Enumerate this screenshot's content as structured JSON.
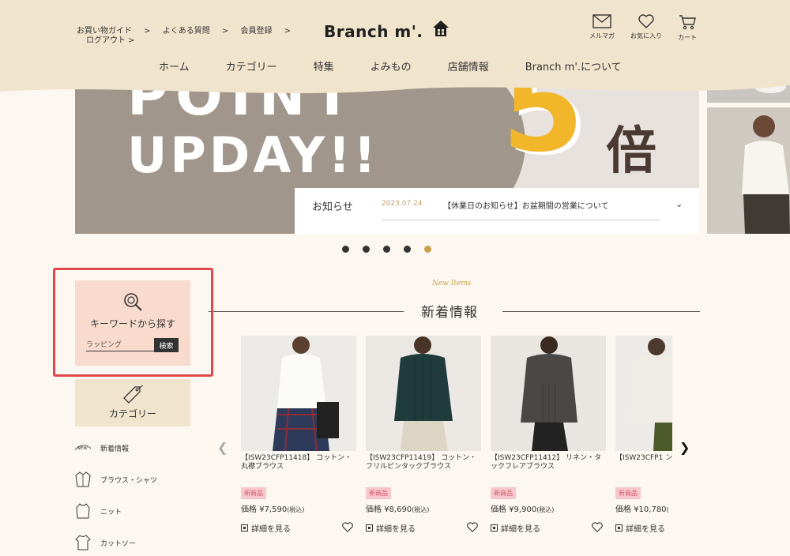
{
  "header": {
    "guide_links_row1": [
      "お買い物ガイド",
      "よくある質問",
      "会員登録"
    ],
    "guide_links_row2": [
      "ログアウト"
    ],
    "logo_text": "Branch m'.",
    "icons": [
      {
        "name": "mail-icon",
        "label": "メルマガ"
      },
      {
        "name": "heart-icon",
        "label": "お気に入り"
      },
      {
        "name": "cart-icon",
        "label": "カート"
      }
    ],
    "nav": [
      "ホーム",
      "カテゴリー",
      "特集",
      "よみもの",
      "店舗情報",
      "Branch m'.について"
    ],
    "bg_color": "#f1e4cc"
  },
  "hero": {
    "line1": "POINT",
    "line2": "UPDAY!!",
    "number": "5",
    "suffix": "倍",
    "accent_color": "#f2b62b"
  },
  "notice": {
    "title": "お知らせ",
    "date": "2023.07.24",
    "text": "【休業日のお知らせ】お盆期間の営業について"
  },
  "slider": {
    "dot_count": 5,
    "active_index": 4
  },
  "search": {
    "icon": "search-icon",
    "title": "キーワードから探す",
    "value": "ラッピング",
    "button": "検索"
  },
  "category": {
    "title": "カテゴリー",
    "items": [
      {
        "icon": "new-icon",
        "label": "新着情報"
      },
      {
        "icon": "shirt-icon",
        "label": "ブラウス・シャツ"
      },
      {
        "icon": "knit-icon",
        "label": "ニット"
      },
      {
        "icon": "cutsew-icon",
        "label": "カットソー"
      }
    ]
  },
  "new_items": {
    "title_en": "New Items",
    "title_jp": "新着情報",
    "products": [
      {
        "code": "【ISW23CFP11418】",
        "name": "コットン・丸襟ブラウス",
        "badge": "新商品",
        "price_label": "価格",
        "price": "¥7,590",
        "tax": "(税込)",
        "detail": "詳細を見る"
      },
      {
        "code": "【ISW23CFP11419】",
        "name": "コットン・フリルピンタックブラウス",
        "badge": "新商品",
        "price_label": "価格",
        "price": "¥8,690",
        "tax": "(税込)",
        "detail": "詳細を見る"
      },
      {
        "code": "【ISW23CFP11412】",
        "name": "リネン・タックフレアブラウス",
        "badge": "新商品",
        "price_label": "価格",
        "price": "¥9,900",
        "tax": "(税込)",
        "detail": "詳細を見る"
      },
      {
        "code": "【ISW23CFP1",
        "name": "ン・丸襟チュニ",
        "badge": "新商品",
        "price_label": "価格",
        "price": "¥10,780",
        "tax": "(",
        "detail": "詳細を見る"
      }
    ]
  }
}
